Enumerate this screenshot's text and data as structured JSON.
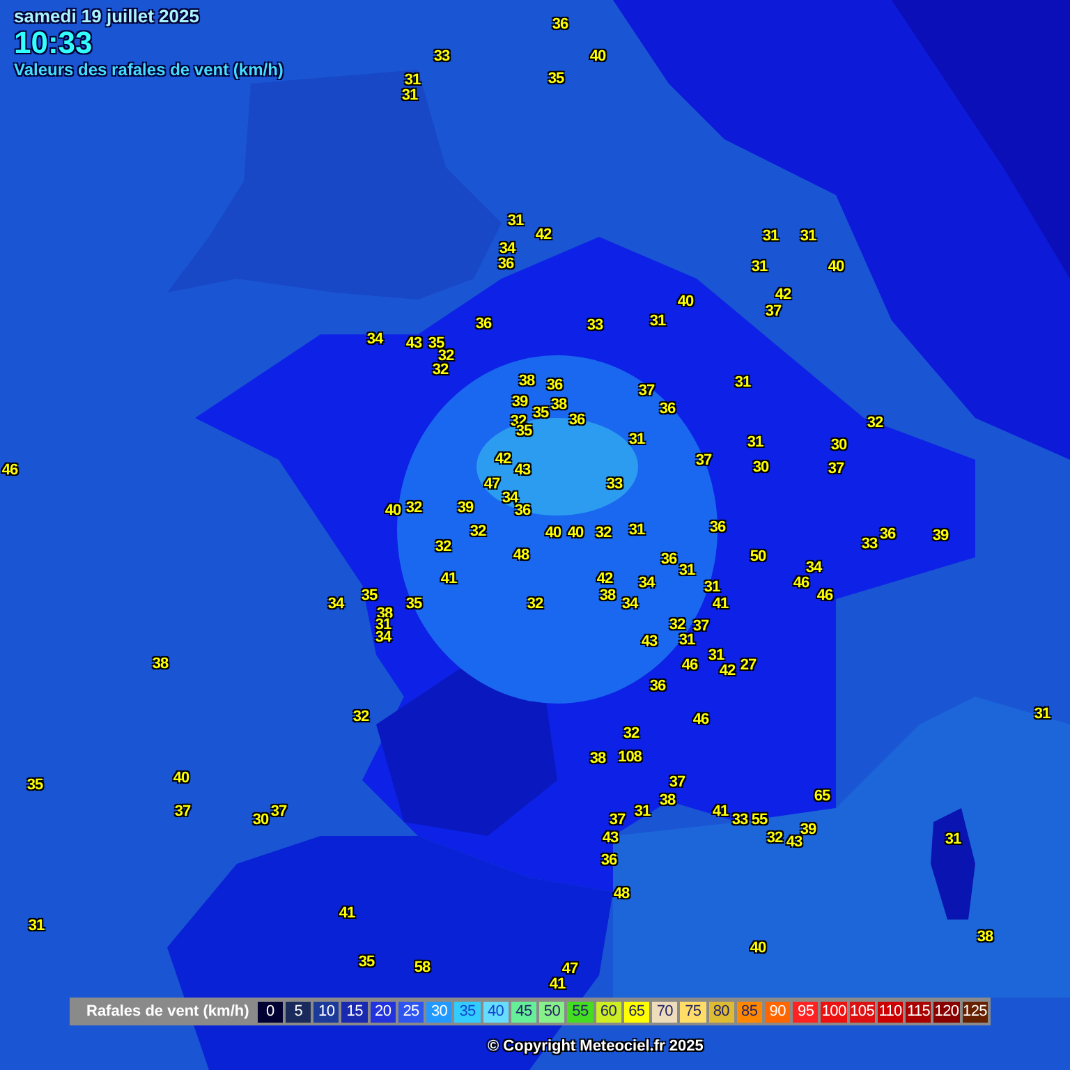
{
  "header": {
    "date": "samedi 19 juillet 2025",
    "time": "10:33",
    "subtitle": "Valeurs des rafales de vent (km/h)"
  },
  "stations": [
    {
      "value": "36"
    },
    {
      "value": "33"
    },
    {
      "value": "40"
    },
    {
      "value": "31"
    },
    {
      "value": "35"
    },
    {
      "value": "31"
    },
    {
      "value": "31"
    },
    {
      "value": "42"
    },
    {
      "value": "31"
    },
    {
      "value": "31"
    },
    {
      "value": "34"
    },
    {
      "value": "36"
    },
    {
      "value": "31"
    },
    {
      "value": "40"
    },
    {
      "value": "40"
    },
    {
      "value": "42"
    },
    {
      "value": "37"
    },
    {
      "value": "36"
    },
    {
      "value": "33"
    },
    {
      "value": "31"
    },
    {
      "value": "34"
    },
    {
      "value": "43"
    },
    {
      "value": "35"
    },
    {
      "value": "32"
    },
    {
      "value": "32"
    },
    {
      "value": "38"
    },
    {
      "value": "36"
    },
    {
      "value": "31"
    },
    {
      "value": "37"
    },
    {
      "value": "39"
    },
    {
      "value": "38"
    },
    {
      "value": "35"
    },
    {
      "value": "36"
    },
    {
      "value": "32"
    },
    {
      "value": "36"
    },
    {
      "value": "32"
    },
    {
      "value": "35"
    },
    {
      "value": "31"
    },
    {
      "value": "31"
    },
    {
      "value": "30"
    },
    {
      "value": "42"
    },
    {
      "value": "37"
    },
    {
      "value": "46"
    },
    {
      "value": "43"
    },
    {
      "value": "30"
    },
    {
      "value": "37"
    },
    {
      "value": "47"
    },
    {
      "value": "33"
    },
    {
      "value": "34"
    },
    {
      "value": "40"
    },
    {
      "value": "32"
    },
    {
      "value": "39"
    },
    {
      "value": "36"
    },
    {
      "value": "32"
    },
    {
      "value": "40"
    },
    {
      "value": "40"
    },
    {
      "value": "32"
    },
    {
      "value": "31"
    },
    {
      "value": "36"
    },
    {
      "value": "36"
    },
    {
      "value": "39"
    },
    {
      "value": "32"
    },
    {
      "value": "33"
    },
    {
      "value": "48"
    },
    {
      "value": "36"
    },
    {
      "value": "50"
    },
    {
      "value": "31"
    },
    {
      "value": "34"
    },
    {
      "value": "41"
    },
    {
      "value": "42"
    },
    {
      "value": "34"
    },
    {
      "value": "31"
    },
    {
      "value": "46"
    },
    {
      "value": "35"
    },
    {
      "value": "38"
    },
    {
      "value": "46"
    },
    {
      "value": "34"
    },
    {
      "value": "35"
    },
    {
      "value": "32"
    },
    {
      "value": "34"
    },
    {
      "value": "41"
    },
    {
      "value": "38"
    },
    {
      "value": "31"
    },
    {
      "value": "32"
    },
    {
      "value": "37"
    },
    {
      "value": "34"
    },
    {
      "value": "43"
    },
    {
      "value": "31"
    },
    {
      "value": "31"
    },
    {
      "value": "38"
    },
    {
      "value": "46"
    },
    {
      "value": "42"
    },
    {
      "value": "27"
    },
    {
      "value": "36"
    },
    {
      "value": "32"
    },
    {
      "value": "46"
    },
    {
      "value": "31"
    },
    {
      "value": "32"
    },
    {
      "value": "38"
    },
    {
      "value": "108"
    },
    {
      "value": "35"
    },
    {
      "value": "40"
    },
    {
      "value": "37"
    },
    {
      "value": "38"
    },
    {
      "value": "65"
    },
    {
      "value": "37"
    },
    {
      "value": "37"
    },
    {
      "value": "31"
    },
    {
      "value": "41"
    },
    {
      "value": "30"
    },
    {
      "value": "37"
    },
    {
      "value": "33"
    },
    {
      "value": "55"
    },
    {
      "value": "39"
    },
    {
      "value": "43"
    },
    {
      "value": "32"
    },
    {
      "value": "43"
    },
    {
      "value": "31"
    },
    {
      "value": "36"
    },
    {
      "value": "48"
    },
    {
      "value": "41"
    },
    {
      "value": "31"
    },
    {
      "value": "38"
    },
    {
      "value": "40"
    },
    {
      "value": "35"
    },
    {
      "value": "58"
    },
    {
      "value": "47"
    },
    {
      "value": "41"
    }
  ],
  "legend": {
    "title": "Rafales de vent (km/h)",
    "steps": [
      {
        "label": "0",
        "color": "#000033"
      },
      {
        "label": "5",
        "color": "#1a2a5a"
      },
      {
        "label": "10",
        "color": "#1c3a9a"
      },
      {
        "label": "15",
        "color": "#1a2ab0"
      },
      {
        "label": "20",
        "color": "#2233dd"
      },
      {
        "label": "25",
        "color": "#2d55f0"
      },
      {
        "label": "30",
        "color": "#2299ff"
      },
      {
        "label": "35",
        "color": "#33ccff"
      },
      {
        "label": "40",
        "color": "#66ddff"
      },
      {
        "label": "45",
        "color": "#66ee99"
      },
      {
        "label": "50",
        "color": "#88f088"
      },
      {
        "label": "55",
        "color": "#44dd22"
      },
      {
        "label": "60",
        "color": "#ccee22"
      },
      {
        "label": "65",
        "color": "#ffff00"
      },
      {
        "label": "70",
        "color": "#eeddbb"
      },
      {
        "label": "75",
        "color": "#ffdd66"
      },
      {
        "label": "80",
        "color": "#ddbb33"
      },
      {
        "label": "85",
        "color": "#ff8800"
      },
      {
        "label": "90",
        "color": "#ff6600"
      },
      {
        "label": "95",
        "color": "#ff2222"
      },
      {
        "label": "100",
        "color": "#ee1111"
      },
      {
        "label": "105",
        "color": "#dd1111"
      },
      {
        "label": "110",
        "color": "#cc0000"
      },
      {
        "label": "115",
        "color": "#aa0000"
      },
      {
        "label": "120",
        "color": "#880000"
      },
      {
        "label": "125",
        "color": "#662200"
      }
    ]
  },
  "copyright": "© Copyright Meteociel.fr 2025"
}
